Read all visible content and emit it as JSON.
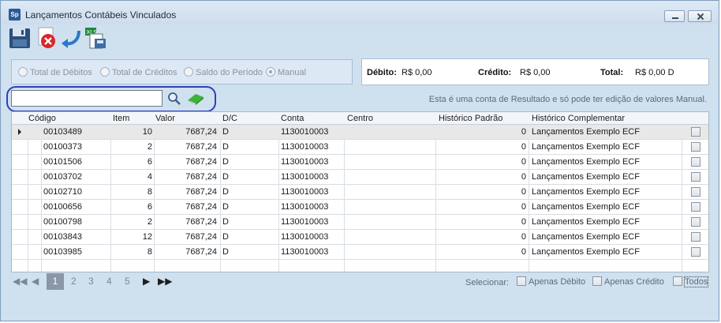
{
  "window": {
    "title": "Lançamentos Contábeis Vinculados",
    "app_icon_text": "Sp"
  },
  "toolbar": {
    "icons": [
      "save-icon",
      "cancel-icon",
      "undo-icon",
      "export-xls-icon"
    ]
  },
  "filters": {
    "options": [
      {
        "label": "Total de Débitos",
        "checked": false
      },
      {
        "label": "Total de Créditos",
        "checked": false
      },
      {
        "label": "Saldo do Período",
        "checked": false
      },
      {
        "label": "Manual",
        "checked": true
      }
    ]
  },
  "totals": {
    "debito_label": "Débito:",
    "debito_value": "R$ 0,00",
    "credito_label": "Crédito:",
    "credito_value": "R$ 0,00",
    "total_label": "Total:",
    "total_value": "R$ 0,00 D"
  },
  "search": {
    "value": "",
    "placeholder": ""
  },
  "info_text": "Esta é uma conta de Resultado e só pode ter edição de valores Manual.",
  "grid": {
    "columns": [
      "Código",
      "Item",
      "Valor",
      "D/C",
      "Conta",
      "Centro",
      "Histórico Padrão",
      "Histórico Complementar"
    ],
    "rows": [
      {
        "codigo": "00103489",
        "item": "10",
        "valor": "7687,24",
        "dc": "D",
        "conta": "1130010003",
        "centro": "",
        "hist_padrao": "0",
        "hist_comp": "Lançamentos Exemplo ECF"
      },
      {
        "codigo": "00100373",
        "item": "2",
        "valor": "7687,24",
        "dc": "D",
        "conta": "1130010003",
        "centro": "",
        "hist_padrao": "0",
        "hist_comp": "Lançamentos Exemplo ECF"
      },
      {
        "codigo": "00101506",
        "item": "6",
        "valor": "7687,24",
        "dc": "D",
        "conta": "1130010003",
        "centro": "",
        "hist_padrao": "0",
        "hist_comp": "Lançamentos Exemplo ECF"
      },
      {
        "codigo": "00103702",
        "item": "4",
        "valor": "7687,24",
        "dc": "D",
        "conta": "1130010003",
        "centro": "",
        "hist_padrao": "0",
        "hist_comp": "Lançamentos Exemplo ECF"
      },
      {
        "codigo": "00102710",
        "item": "8",
        "valor": "7687,24",
        "dc": "D",
        "conta": "1130010003",
        "centro": "",
        "hist_padrao": "0",
        "hist_comp": "Lançamentos Exemplo ECF"
      },
      {
        "codigo": "00100656",
        "item": "6",
        "valor": "7687,24",
        "dc": "D",
        "conta": "1130010003",
        "centro": "",
        "hist_padrao": "0",
        "hist_comp": "Lançamentos Exemplo ECF"
      },
      {
        "codigo": "00100798",
        "item": "2",
        "valor": "7687,24",
        "dc": "D",
        "conta": "1130010003",
        "centro": "",
        "hist_padrao": "0",
        "hist_comp": "Lançamentos Exemplo ECF"
      },
      {
        "codigo": "00103843",
        "item": "12",
        "valor": "7687,24",
        "dc": "D",
        "conta": "1130010003",
        "centro": "",
        "hist_padrao": "0",
        "hist_comp": "Lançamentos Exemplo ECF"
      },
      {
        "codigo": "00103985",
        "item": "8",
        "valor": "7687,24",
        "dc": "D",
        "conta": "1130010003",
        "centro": "",
        "hist_padrao": "0",
        "hist_comp": "Lançamentos Exemplo ECF"
      }
    ]
  },
  "pager": {
    "pages": [
      "1",
      "2",
      "3",
      "4",
      "5"
    ],
    "current": "1"
  },
  "selection": {
    "label": "Selecionar:",
    "options": [
      "Apenas Débito",
      "Apenas Crédito",
      "Todos"
    ]
  }
}
